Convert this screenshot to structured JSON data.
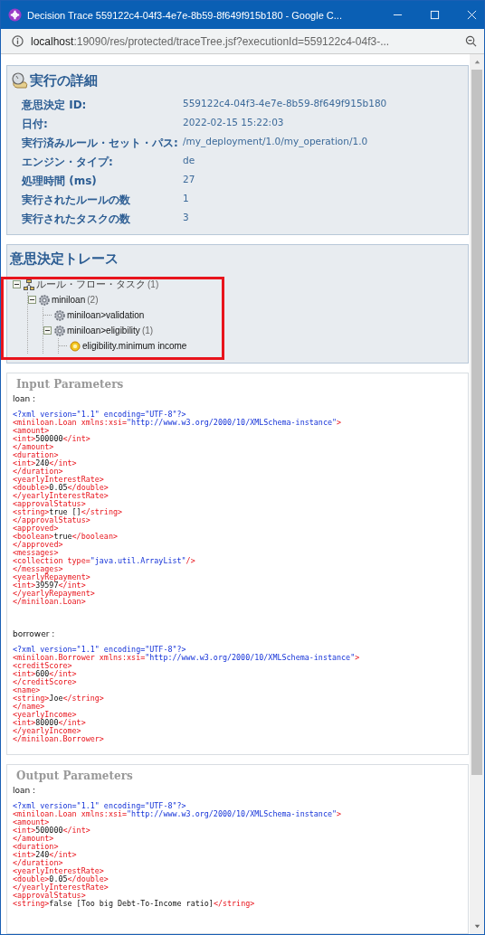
{
  "window": {
    "title": "Decision Trace 559122c4-04f3-4e7e-8b59-8f649f915b180 - Google C..."
  },
  "address_bar": {
    "host": "localhost",
    "path": ":19090/res/protected/traceTree.jsf?executionId=559122c4-04f3-..."
  },
  "details": {
    "title": "実行の詳細",
    "rows": [
      {
        "label": "意思決定 ID:",
        "value": "559122c4-04f3-4e7e-8b59-8f649f915b180"
      },
      {
        "label": "日付:",
        "value": "2022-02-15 15:22:03"
      },
      {
        "label": "実行済みルール・セット・パス:",
        "value": "/my_deployment/1.0/my_operation/1.0"
      },
      {
        "label": "エンジン・タイプ:",
        "value": "de"
      },
      {
        "label": "処理時間 (ms)",
        "value": "27"
      },
      {
        "label": "実行されたルールの数",
        "value": "1"
      },
      {
        "label": "実行されたタスクの数",
        "value": "3"
      }
    ]
  },
  "trace": {
    "title": "意思決定トレース",
    "tree": [
      {
        "kind": "flow",
        "label": "ルール・フロー・タスク",
        "count": "(1)",
        "expanded": true,
        "children": [
          {
            "kind": "task",
            "label": "miniloan",
            "count": "(2)",
            "expanded": true,
            "children": [
              {
                "kind": "task",
                "label": "miniloan>validation"
              },
              {
                "kind": "task",
                "label": "miniloan>eligibility",
                "count": "(1)",
                "expanded": true,
                "children": [
                  {
                    "kind": "rule",
                    "label": "eligibility.minimum income"
                  }
                ]
              }
            ]
          }
        ]
      }
    ]
  },
  "input_parameters": {
    "title": "Input Parameters",
    "params": [
      {
        "name": "loan :",
        "xml": [
          "<?xml version=\"1.1\" encoding=\"UTF-8\"?>",
          "<miniloan.Loan xmlns:xsi=\"http://www.w3.org/2000/10/XMLSchema-instance\">",
          "<amount>",
          "<int>500000</int>",
          "</amount>",
          "<duration>",
          "<int>240</int>",
          "</duration>",
          "<yearlyInterestRate>",
          "<double>0.05</double>",
          "</yearlyInterestRate>",
          "<approvalStatus>",
          "<string>true []</string>",
          "</approvalStatus>",
          "<approved>",
          "<boolean>true</boolean>",
          "</approved>",
          "<messages>",
          "<collection type=\"java.util.ArrayList\"/>",
          "</messages>",
          "<yearlyRepayment>",
          "<int>39597</int>",
          "</yearlyRepayment>",
          "</miniloan.Loan>"
        ]
      },
      {
        "name": "borrower :",
        "xml": [
          "<?xml version=\"1.1\" encoding=\"UTF-8\"?>",
          "<miniloan.Borrower xmlns:xsi=\"http://www.w3.org/2000/10/XMLSchema-instance\">",
          "<creditScore>",
          "<int>600</int>",
          "</creditScore>",
          "<name>",
          "<string>Joe</string>",
          "</name>",
          "<yearlyIncome>",
          "<int>80000</int>",
          "</yearlyIncome>",
          "</miniloan.Borrower>"
        ]
      }
    ]
  },
  "output_parameters": {
    "title": "Output Parameters",
    "params": [
      {
        "name": "loan :",
        "xml": [
          "<?xml version=\"1.1\" encoding=\"UTF-8\"?>",
          "<miniloan.Loan xmlns:xsi=\"http://www.w3.org/2000/10/XMLSchema-instance\">",
          "<amount>",
          "<int>500000</int>",
          "</amount>",
          "<duration>",
          "<int>240</int>",
          "</duration>",
          "<yearlyInterestRate>",
          "<double>0.05</double>",
          "</yearlyInterestRate>",
          "<approvalStatus>",
          "<string>false [Too big Debt-To-Income ratio]</string>"
        ]
      }
    ]
  }
}
